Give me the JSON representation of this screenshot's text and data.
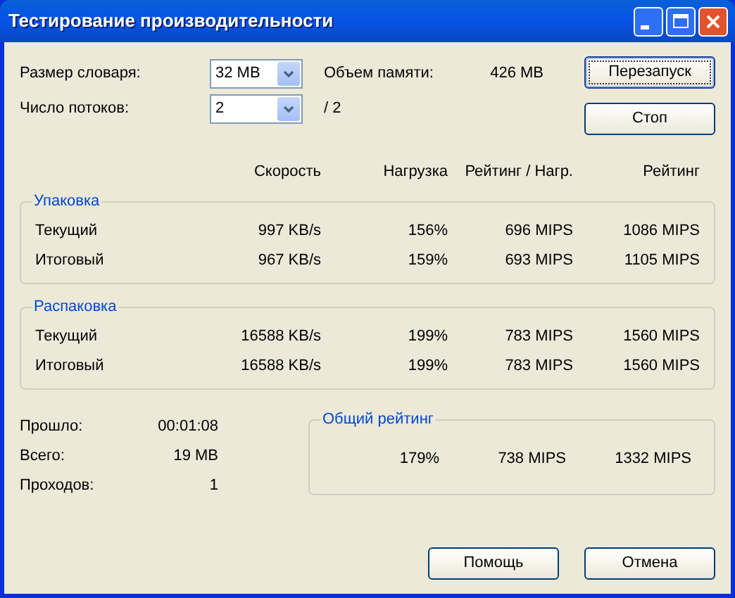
{
  "window": {
    "title": "Тестирование производительности"
  },
  "settings": [
    {
      "label": "Размер словаря:",
      "value": "32 MB",
      "info_label": "Объем памяти:",
      "info_value": "426 MB"
    },
    {
      "label": "Число потоков:",
      "value": "2",
      "info_label": "/ 2"
    }
  ],
  "side_buttons": [
    {
      "label": "Перезапуск",
      "focused": true
    },
    {
      "label": "Стоп",
      "focused": false
    }
  ],
  "columns": [
    "Скорость",
    "Нагрузка",
    "Рейтинг / Нагр.",
    "Рейтинг"
  ],
  "groups": [
    {
      "title": "Упаковка",
      "rows": [
        {
          "label": "Текущий",
          "values": [
            "997 KB/s",
            "156%",
            "696 MIPS",
            "1086 MIPS"
          ]
        },
        {
          "label": "Итоговый",
          "values": [
            "967 KB/s",
            "159%",
            "693 MIPS",
            "1105 MIPS"
          ]
        }
      ]
    },
    {
      "title": "Распаковка",
      "rows": [
        {
          "label": "Текущий",
          "values": [
            "16588 KB/s",
            "199%",
            "783 MIPS",
            "1560 MIPS"
          ]
        },
        {
          "label": "Итоговый",
          "values": [
            "16588 KB/s",
            "199%",
            "783 MIPS",
            "1560 MIPS"
          ]
        }
      ]
    }
  ],
  "stats": [
    {
      "label": "Прошло:",
      "value": "00:01:08"
    },
    {
      "label": "Всего:",
      "value": "19 MB"
    },
    {
      "label": "Проходов:",
      "value": "1"
    }
  ],
  "total": {
    "title": "Общий рейтинг",
    "values": [
      "179%",
      "738 MIPS",
      "1332 MIPS"
    ]
  },
  "bottom_buttons": [
    {
      "label": "Помощь",
      "focused": false
    },
    {
      "label": "Отмена",
      "focused": false
    }
  ]
}
